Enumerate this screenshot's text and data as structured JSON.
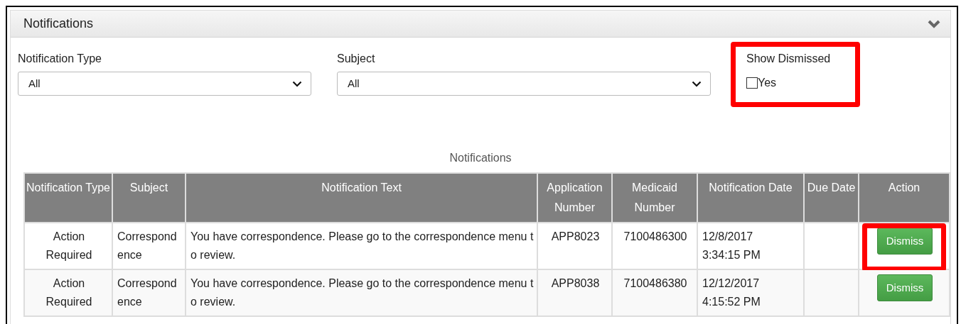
{
  "panel": {
    "title": "Notifications",
    "expanded": true
  },
  "filters": [
    {
      "label": "Notification Type",
      "value": "All"
    },
    {
      "label": "Subject",
      "value": "All"
    }
  ],
  "show_dismissed": {
    "label": "Show Dismissed",
    "option": "Yes",
    "checked": false,
    "highlighted": true
  },
  "table": {
    "caption": "Notifications",
    "columns": [
      "Notification Type",
      "Subject",
      "Notification Text",
      "Application Number",
      "Medicaid Number",
      "Notification Date",
      "Due Date",
      "Action"
    ],
    "rows": [
      {
        "type": "Action Required",
        "subject": "Correspondence",
        "text": "You have correspondence. Please go to the correspondence menu to review.",
        "application": "APP8023",
        "medicaid": "7100486300",
        "date": "12/8/2017",
        "time": "3:34:15 PM",
        "action": "Dismiss",
        "highlighted": true
      },
      {
        "type": "Action Required",
        "subject": "Correspondence",
        "text": "You have correspondence. Please go to the correspondence menu to review.",
        "application": "APP8038",
        "medicaid": "7100486380",
        "date": "12/12/2017",
        "time": "4:15:52 PM",
        "action": "Dismiss",
        "highlighted": false
      }
    ]
  }
}
